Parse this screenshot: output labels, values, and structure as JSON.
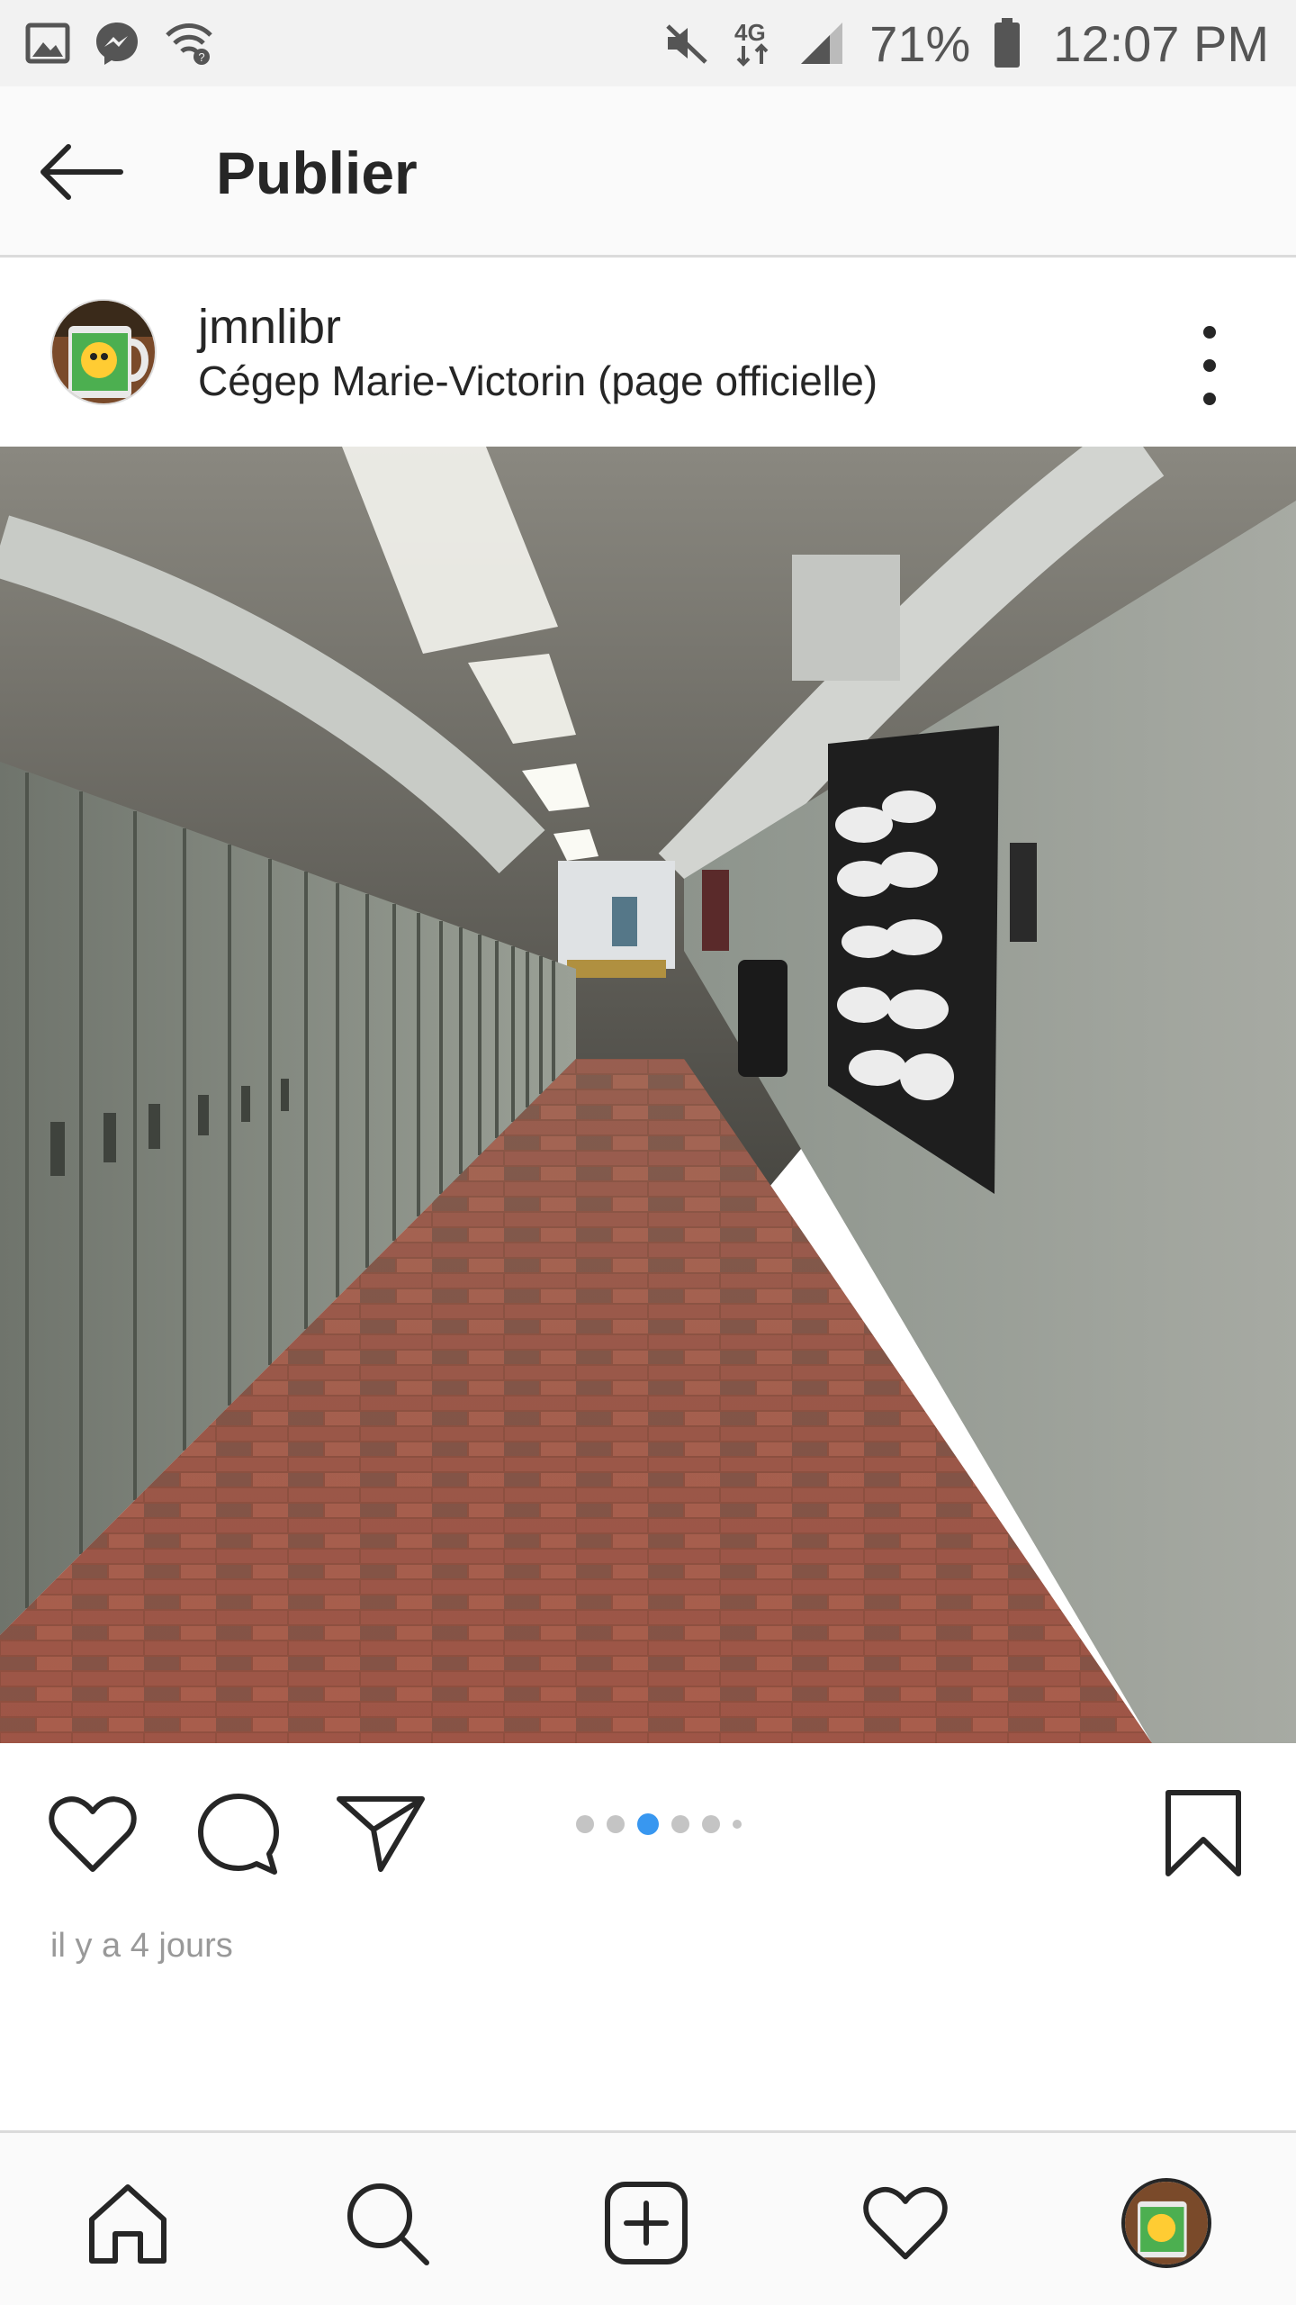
{
  "status_bar": {
    "battery": "71%",
    "time": "12:07 PM",
    "network": "4G",
    "icons": [
      "gallery-icon",
      "messenger-icon",
      "wifi-icon",
      "mute-icon",
      "signal-icon",
      "battery-icon"
    ]
  },
  "header": {
    "title": "Publier",
    "back_icon": "back-arrow-icon"
  },
  "post": {
    "username": "jmnlibr",
    "location": "Cégep Marie-Victorin (page officielle)",
    "more_icon": "more-vertical-icon",
    "photo_description_icon": "hallway-photo",
    "carousel": {
      "total": 6,
      "active_index": 2
    },
    "actions": [
      "like-icon",
      "comment-icon",
      "share-icon",
      "bookmark-icon"
    ],
    "timestamp": "il y a 4 jours"
  },
  "bottom_nav": {
    "items": [
      "home-icon",
      "search-icon",
      "add-post-icon",
      "activity-icon",
      "profile-avatar"
    ]
  },
  "colors": {
    "accent": "#3897f0",
    "text": "#262626",
    "muted": "#999999"
  }
}
